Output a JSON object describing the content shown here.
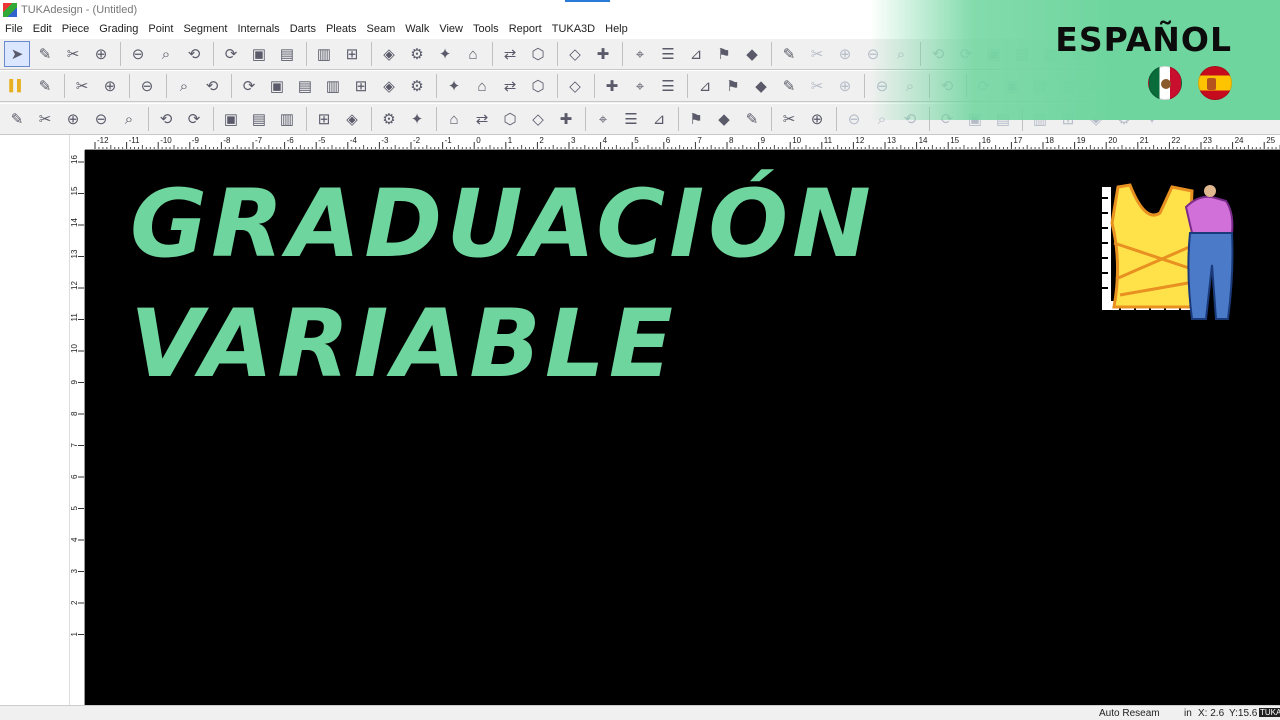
{
  "window": {
    "title": "TUKAdesign - (Untitled)"
  },
  "menu": [
    "File",
    "Edit",
    "Piece",
    "Grading",
    "Point",
    "Segment",
    "Internals",
    "Darts",
    "Pleats",
    "Seam",
    "Walk",
    "View",
    "Tools",
    "Report",
    "TUKA3D",
    "Help"
  ],
  "toolbars": {
    "row1": [
      "arrow-select-icon",
      "new-file-icon",
      "open-folder-icon",
      "save-icon",
      "|",
      "print-icon",
      "plot-icon",
      "export-icon",
      "|",
      "cut-icon",
      "copy-icon",
      "paste-icon",
      "|",
      "undo-icon",
      "redo-icon",
      "|",
      "zoom-in-icon",
      "zoom-out-icon",
      "zoom-fit-icon",
      "zoom-window-icon",
      "|",
      "help-icon",
      "measure-icon",
      "|",
      "piece-info-icon",
      "piece-icon",
      "|",
      "grade-a-icon",
      "grade-b-icon",
      "grade-c-icon",
      "grade-d-icon",
      "grade-e-icon",
      "|",
      "machine-icon",
      "seam-a-icon",
      "seam-b-icon",
      "seam-c-icon",
      "seam-d-icon",
      "|",
      "notch-a-icon",
      "notch-b-icon",
      "notch-c-icon",
      "notch-d-icon",
      "notch-e-icon",
      "notch-f-icon",
      "notch-g-icon"
    ],
    "row2": [
      "yellow-bars-icon",
      "ruler-icon",
      "|",
      "pencil-icon",
      "walk-icon",
      "|",
      "double-arrow-icon",
      "|",
      "add-point-icon",
      "corner-icon",
      "|",
      "hammer-icon",
      "circle-plus-icon",
      "pin-icon",
      "compass-icon",
      "magnet-icon",
      "text-icon",
      "image-icon",
      "|",
      "line-a-icon",
      "line-b-icon",
      "line-c-icon",
      "line-d-icon",
      "|",
      "globe-icon",
      "|",
      "dart-a-icon",
      "dart-b-icon",
      "dart-c-icon",
      "|",
      "pleat-a-icon",
      "pleat-b-icon",
      "pleat-c-icon",
      "pleat-d-icon",
      "pleat-e-icon",
      "pleat-f-icon",
      "|",
      "fold-a-icon",
      "fold-b-icon",
      "|",
      "arrow-right-icon",
      "|",
      "mark-a-icon",
      "mark-b-icon",
      "mark-c-icon",
      "mark-d-icon",
      "mark-e-icon"
    ],
    "row3": [
      "knife-icon",
      "anchor-icon",
      "chain-icon",
      "grid-icon",
      "slope-icon",
      "|",
      "vert-a-icon",
      "vert-b-icon",
      "|",
      "sew-a-icon",
      "sew-b-icon",
      "sew-c-icon",
      "|",
      "frame-icon",
      "tag-icon",
      "|",
      "mirror-a-icon",
      "mirror-b-icon",
      "|",
      "lasso-a-icon",
      "lasso-b-icon",
      "lasso-c-icon",
      "lasso-d-icon",
      "lasso-e-icon",
      "|",
      "angle-a-icon",
      "angle-b-icon",
      "angle-c-icon",
      "|",
      "measure-a-icon",
      "measure-b-icon",
      "label-icon",
      "|",
      "trace-a-icon",
      "trace-b-icon",
      "|",
      "scissors-icon",
      "brush-icon",
      "tape-icon",
      "|",
      "green-a-icon",
      "green-b-icon",
      "green-c-icon",
      "|",
      "sym-a-icon",
      "sym-b-icon",
      "sym-c-icon",
      "sym-d-icon",
      "sym-e-icon"
    ]
  },
  "ruler": {
    "top_ticks": [
      "-12",
      "-11",
      "-10",
      "-9",
      "-8",
      "-7",
      "-6",
      "-5",
      "-4",
      "-3",
      "-2",
      "-1",
      "0",
      "1",
      "2",
      "3",
      "4",
      "5",
      "6",
      "7",
      "8",
      "9",
      "10",
      "11",
      "12",
      "13",
      "14",
      "15",
      "16",
      "17",
      "18",
      "19",
      "20",
      "21",
      "22",
      "23",
      "24",
      "25"
    ],
    "left_ticks": [
      "16",
      "15",
      "14",
      "13",
      "12",
      "11",
      "10",
      "9",
      "8",
      "7",
      "6",
      "5",
      "4",
      "3",
      "2",
      "1"
    ]
  },
  "canvas": {
    "headline_line1": "GRADUACIÓN",
    "headline_line2": "VARIABLE"
  },
  "badge": {
    "text": "ESPAÑOL",
    "flags": [
      "mexico-flag-icon",
      "spain-flag-icon"
    ]
  },
  "status": {
    "mode": "Auto Reseam",
    "units": "in",
    "x": "X: 2.6",
    "y": "Y:15.6",
    "brand": "TUKA"
  },
  "colors": {
    "accent_green": "#6ed59e",
    "canvas_bg": "#000000"
  }
}
